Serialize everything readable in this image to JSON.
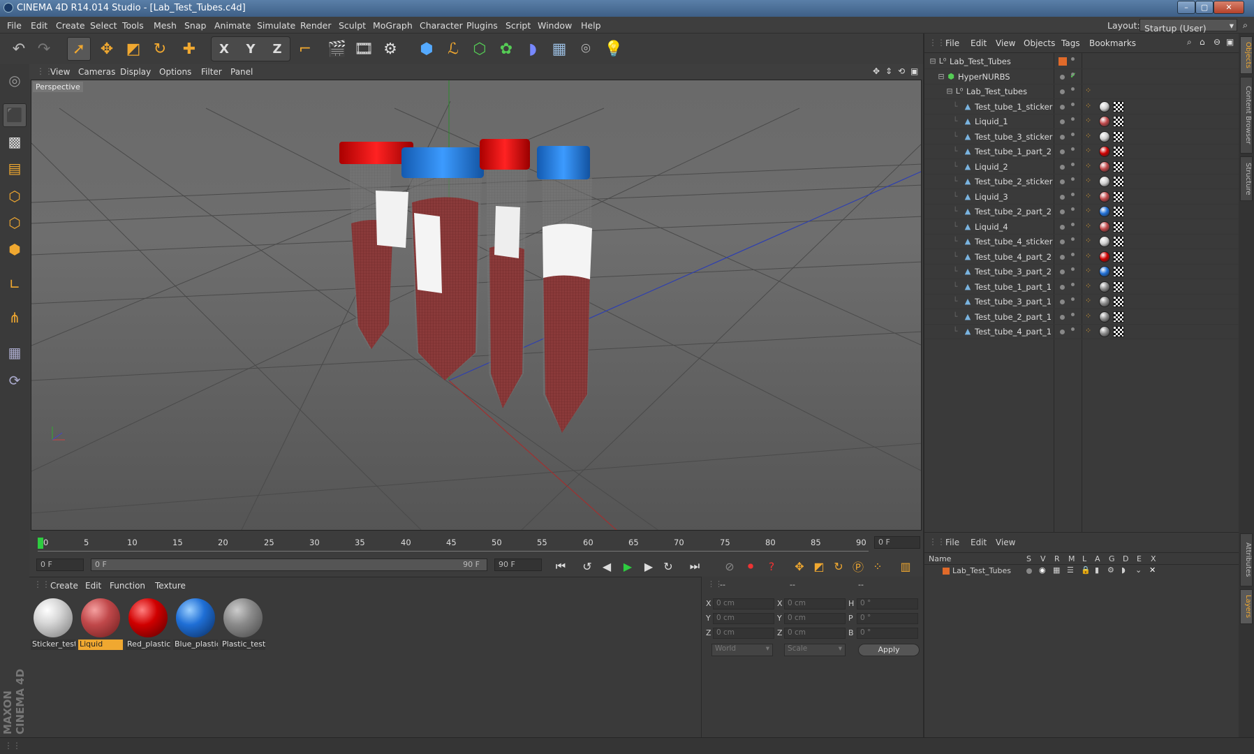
{
  "window": {
    "title": "CINEMA 4D R14.014 Studio - [Lab_Test_Tubes.c4d]"
  },
  "menu": {
    "items": [
      "File",
      "Edit",
      "Create",
      "Select",
      "Tools",
      "Mesh",
      "Snap",
      "Animate",
      "Simulate",
      "Render",
      "Sculpt",
      "MoGraph",
      "Character",
      "Plugins",
      "Script",
      "Window",
      "Help"
    ],
    "layout_label": "Layout:",
    "layout_value": "Startup (User)"
  },
  "toolbar": {
    "icons": [
      "undo-icon",
      "redo-icon",
      "live-select-icon",
      "move-icon",
      "scale-icon",
      "rotate-icon",
      "transform-icon",
      "x-axis-icon",
      "y-axis-icon",
      "z-axis-icon",
      "coord-system-icon",
      "render-view-icon",
      "render-picture-viewer-icon",
      "edit-render-settings-icon",
      "cube-icon",
      "spline-icon",
      "nurbs-icon",
      "array-icon",
      "deformer-icon",
      "floor-icon",
      "camera-icon",
      "light-icon"
    ],
    "axis": [
      "X",
      "Y",
      "Z"
    ]
  },
  "viewport": {
    "menu": [
      "View",
      "Cameras",
      "Display",
      "Options",
      "Filter",
      "Panel"
    ],
    "label": "Perspective"
  },
  "timeline": {
    "ticks": [
      "0",
      "5",
      "10",
      "15",
      "20",
      "25",
      "30",
      "35",
      "40",
      "45",
      "50",
      "55",
      "60",
      "65",
      "70",
      "75",
      "80",
      "85",
      "90"
    ],
    "current_frame": "0 F"
  },
  "transport": {
    "start": "0 F",
    "range_start": "0 F",
    "range_end": "90 F",
    "end": "90 F"
  },
  "materials": {
    "menu": [
      "Create",
      "Edit",
      "Function",
      "Texture"
    ],
    "items": [
      {
        "name": "Sticker_test",
        "color": "#d8d8d8"
      },
      {
        "name": "Liquid",
        "color": "#c0484a",
        "selected": true
      },
      {
        "name": "Red_plastic",
        "color": "#d00000"
      },
      {
        "name": "Blue_plastic",
        "color": "#1f6fd6"
      },
      {
        "name": "Plastic_test",
        "color": "#8a8a8a"
      }
    ]
  },
  "coordinates": {
    "header": [
      "--",
      "--",
      "--"
    ],
    "rows": [
      {
        "l1": "X",
        "v1": "0 cm",
        "l2": "X",
        "v2": "0 cm",
        "l3": "H",
        "v3": "0 °"
      },
      {
        "l1": "Y",
        "v1": "0 cm",
        "l2": "Y",
        "v2": "0 cm",
        "l3": "P",
        "v3": "0 °"
      },
      {
        "l1": "Z",
        "v1": "0 cm",
        "l2": "Z",
        "v2": "0 cm",
        "l3": "B",
        "v3": "0 °"
      }
    ],
    "space": "World",
    "mode": "Scale",
    "apply": "Apply"
  },
  "objects": {
    "menu": [
      "File",
      "Edit",
      "View",
      "Objects",
      "Tags",
      "Bookmarks"
    ],
    "tree": [
      {
        "name": "Lab_Test_Tubes",
        "depth": 0,
        "icon": "null-icon"
      },
      {
        "name": "HyperNURBS",
        "depth": 1,
        "icon": "hypernurbs-icon"
      },
      {
        "name": "Lab_Test_tubes",
        "depth": 2,
        "icon": "null-icon"
      },
      {
        "name": "Test_tube_1_sticker",
        "depth": 3,
        "tag": "#cfcfcf"
      },
      {
        "name": "Liquid_1",
        "depth": 3,
        "tag": "#c0484a"
      },
      {
        "name": "Test_tube_3_sticker",
        "depth": 3,
        "tag": "#cfcfcf"
      },
      {
        "name": "Test_tube_1_part_2",
        "depth": 3,
        "tag": "#d00000"
      },
      {
        "name": "Liquid_2",
        "depth": 3,
        "tag": "#c0484a"
      },
      {
        "name": "Test_tube_2_sticker",
        "depth": 3,
        "tag": "#cfcfcf"
      },
      {
        "name": "Liquid_3",
        "depth": 3,
        "tag": "#c0484a"
      },
      {
        "name": "Test_tube_2_part_2",
        "depth": 3,
        "tag": "#1f6fd6"
      },
      {
        "name": "Liquid_4",
        "depth": 3,
        "tag": "#c0484a"
      },
      {
        "name": "Test_tube_4_sticker",
        "depth": 3,
        "tag": "#cfcfcf"
      },
      {
        "name": "Test_tube_4_part_2",
        "depth": 3,
        "tag": "#d00000"
      },
      {
        "name": "Test_tube_3_part_2",
        "depth": 3,
        "tag": "#1f6fd6"
      },
      {
        "name": "Test_tube_1_part_1",
        "depth": 3,
        "tag": "#8a8a8a"
      },
      {
        "name": "Test_tube_3_part_1",
        "depth": 3,
        "tag": "#8a8a8a"
      },
      {
        "name": "Test_tube_2_part_1",
        "depth": 3,
        "tag": "#8a8a8a"
      },
      {
        "name": "Test_tube_4_part_1",
        "depth": 3,
        "tag": "#8a8a8a"
      }
    ]
  },
  "layers": {
    "menu": [
      "File",
      "Edit",
      "View"
    ],
    "columns": [
      "Name",
      "S",
      "V",
      "R",
      "M",
      "L",
      "A",
      "G",
      "D",
      "E",
      "X"
    ],
    "rows": [
      {
        "name": "Lab_Test_Tubes"
      }
    ]
  },
  "side_tabs": [
    "Objects",
    "Content Browser",
    "Structure",
    "Attributes",
    "Layers"
  ],
  "brand": "MAXON CINEMA 4D"
}
